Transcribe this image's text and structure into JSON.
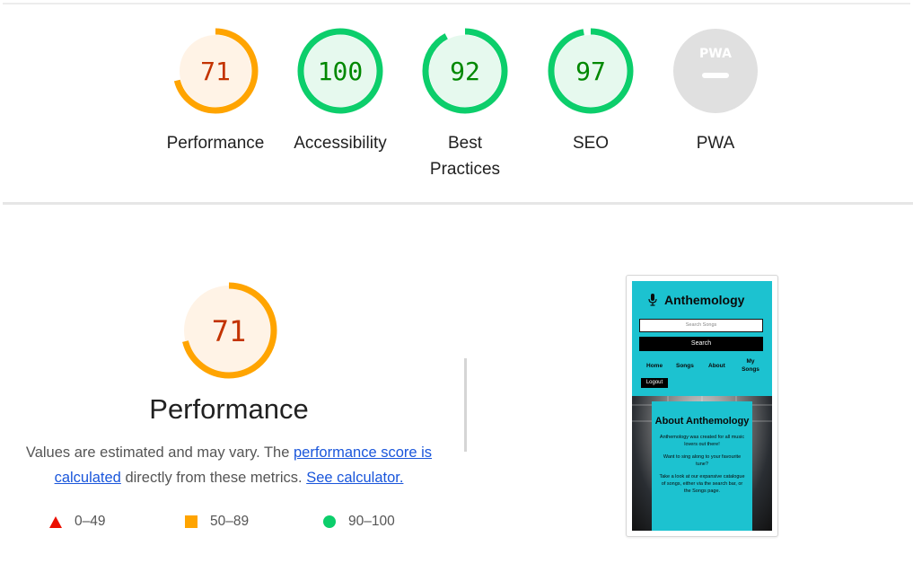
{
  "categories": [
    {
      "label": "Performance",
      "score": "71",
      "value": 71,
      "fg": "#ffa400",
      "bg": "#fff3e6",
      "text": "#c33300"
    },
    {
      "label": "Accessibility",
      "score": "100",
      "value": 100,
      "fg": "#0cce6b",
      "bg": "#e6f9ee",
      "text": "#008800"
    },
    {
      "label": "Best Practices",
      "score": "92",
      "value": 92,
      "fg": "#0cce6b",
      "bg": "#e6f9ee",
      "text": "#008800"
    },
    {
      "label": "SEO",
      "score": "97",
      "value": 97,
      "fg": "#0cce6b",
      "bg": "#e6f9ee",
      "text": "#008800"
    }
  ],
  "pwa": {
    "label": "PWA",
    "badge": "PWA",
    "bg": "#e0e0e0"
  },
  "performance": {
    "score": "71",
    "value": 71,
    "title": "Performance",
    "desc_prefix": "Values are estimated and may vary. The ",
    "link_score": "performance score is calculated",
    "desc_middle": " directly from these metrics. ",
    "link_calc": "See calculator."
  },
  "legend": [
    {
      "shape": "triangle",
      "range": "0–49",
      "color": "#eb0f00"
    },
    {
      "shape": "square",
      "range": "50–89",
      "color": "#ffa400"
    },
    {
      "shape": "circle",
      "range": "90–100",
      "color": "#0cce6b"
    }
  ],
  "screenshot": {
    "brand": "Anthemology",
    "search_placeholder": "Search Songs",
    "search_button": "Search",
    "nav": [
      "Home",
      "Songs",
      "About",
      "My Songs"
    ],
    "logout": "Logout",
    "card_title": "About Anthemology",
    "card_paragraphs": [
      "Anthemology was created for all music lovers out there!",
      "Want to sing along to your favourite tune?",
      "Take a look at our expansive catalogue of songs, either via the search bar, or the Songs page."
    ],
    "accent": "#1cc2d0"
  }
}
